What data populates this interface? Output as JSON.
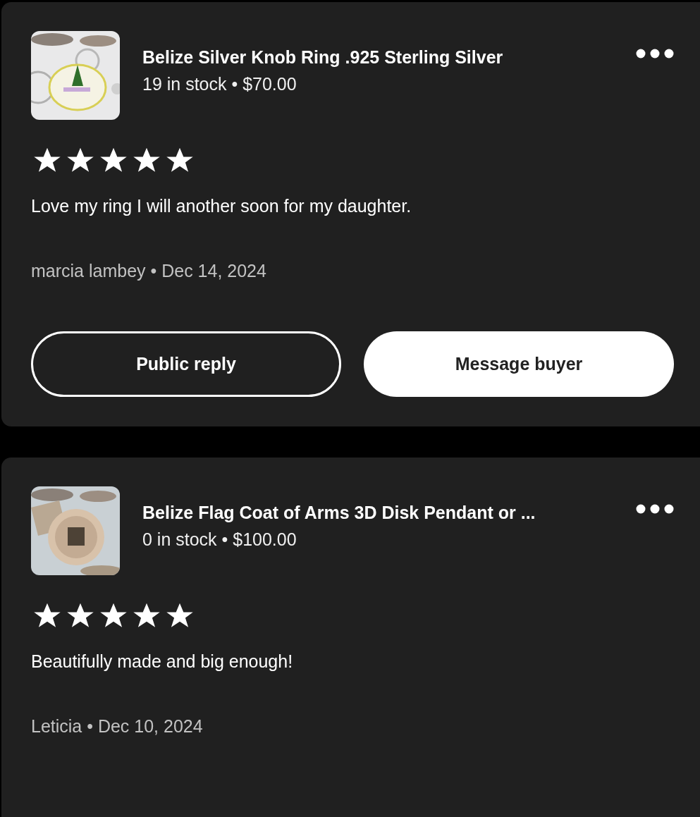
{
  "reviews": [
    {
      "listing": {
        "title": "Belize Silver Knob Ring .925 Sterling Silver",
        "stock_price": "19 in stock • $70.00"
      },
      "stars": 5,
      "text": "Love my ring I will another soon for my daughter.",
      "byline": "marcia lambey • Dec 14, 2024",
      "buttons": [
        {
          "label": "Public reply",
          "kind": "outline"
        },
        {
          "label": "Message buyer",
          "kind": "filled"
        }
      ]
    },
    {
      "listing": {
        "title": "Belize Flag Coat of Arms 3D Disk Pendant or ...",
        "stock_price": "0 in stock • $100.00"
      },
      "stars": 5,
      "text": "Beautifully made and big enough!",
      "byline": "Leticia • Dec 10, 2024"
    }
  ]
}
